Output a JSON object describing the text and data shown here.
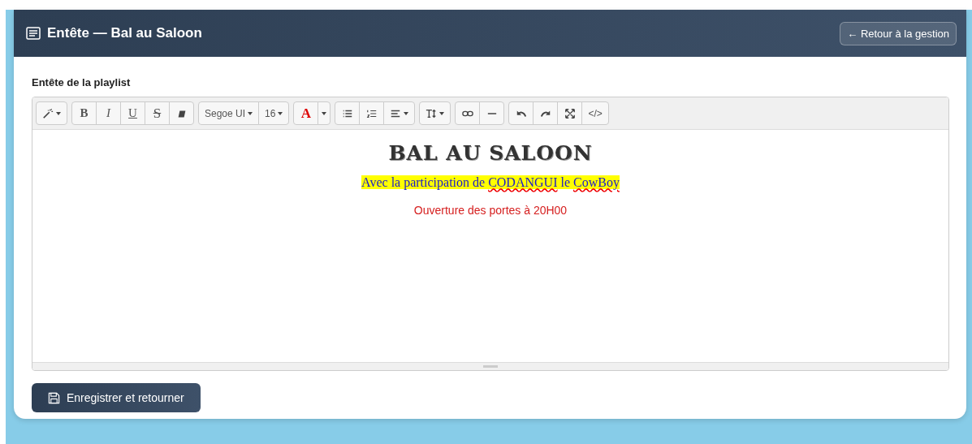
{
  "header": {
    "title": "Entête — Bal au Saloon",
    "back_button": "← Retour à la gestion"
  },
  "field_label": "Entête de la playlist",
  "toolbar": [
    {
      "buttons": [
        {
          "kind": "icon",
          "dropdown": true
        }
      ]
    },
    {
      "buttons": [
        {
          "kind": "bold",
          "label": "B"
        },
        {
          "kind": "italic",
          "label": "I"
        },
        {
          "kind": "underline",
          "label": "U"
        },
        {
          "kind": "strike",
          "label": "S"
        },
        {
          "kind": "icon",
          "dropdown": false
        }
      ]
    },
    {
      "buttons": [
        {
          "kind": "text",
          "label": "Segoe UI",
          "dropdown": true
        },
        {
          "kind": "text",
          "label": "16",
          "dropdown": true
        }
      ]
    },
    {
      "buttons": [
        {
          "kind": "color",
          "label": "A"
        },
        {
          "kind": "caret",
          "dropdown": true
        }
      ]
    },
    {
      "buttons": [
        {
          "kind": "icon",
          "dropdown": false
        },
        {
          "kind": "icon",
          "dropdown": false
        },
        {
          "kind": "icon",
          "dropdown": true
        }
      ]
    },
    {
      "buttons": [
        {
          "kind": "icon",
          "dropdown": true
        }
      ]
    },
    {
      "buttons": [
        {
          "kind": "icon",
          "dropdown": false
        },
        {
          "kind": "icon",
          "dropdown": false
        }
      ]
    },
    {
      "buttons": [
        {
          "kind": "icon",
          "dropdown": false
        },
        {
          "kind": "icon",
          "dropdown": false
        },
        {
          "kind": "icon",
          "dropdown": false
        },
        {
          "kind": "text",
          "label": "</>",
          "dropdown": false
        }
      ]
    }
  ],
  "content": [
    {
      "kind": "title",
      "segments": [
        {
          "text": "BAL AU SALOON",
          "spell_error": false
        }
      ]
    },
    {
      "kind": "highlight",
      "segments": [
        {
          "text": "Avec la participation de ",
          "spell_error": false
        },
        {
          "text": "CODANGUI",
          "spell_error": true
        },
        {
          "text": " le ",
          "spell_error": false
        },
        {
          "text": "CowBoy",
          "spell_error": true
        }
      ]
    },
    {
      "kind": "red",
      "segments": [
        {
          "text": "Ouverture des portes à 20H00",
          "spell_error": false
        }
      ]
    }
  ],
  "save_button": "Enregistrer et retourner"
}
